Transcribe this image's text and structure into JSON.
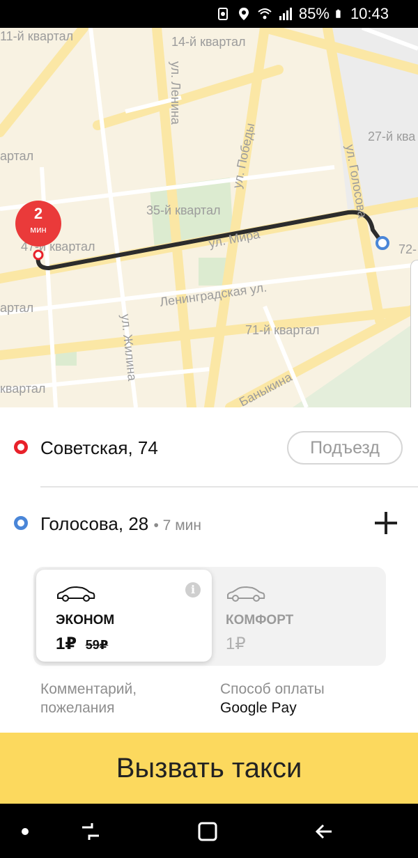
{
  "status_bar": {
    "battery": "85%",
    "time": "10:43"
  },
  "map": {
    "labels": [
      "11-й квартал",
      "14-й квартал",
      "ул. Ленина",
      "ул. Победы",
      "ул. Голосова",
      "27-й ква",
      "артал",
      "35-й квартал",
      "47-й квартал",
      "ул. Мира",
      "72-",
      "артал",
      "Ленинградская ул.",
      "71-й квартал",
      "ул. Жилина",
      "квартал",
      "Баныкина"
    ],
    "eta": {
      "value": "2",
      "unit": "мин"
    }
  },
  "route": {
    "from": {
      "address": "Советская, 74",
      "entrance_label": "Подъезд"
    },
    "to": {
      "address": "Голосова, 28",
      "time": "• 7 мин"
    }
  },
  "tariffs": [
    {
      "name": "ЭКОНОМ",
      "price": "1₽",
      "old_price": "59₽"
    },
    {
      "name": "КОМФОРТ",
      "price": "1₽"
    }
  ],
  "options": {
    "comment": {
      "line1": "Комментарий,",
      "line2": "пожелания"
    },
    "payment": {
      "label": "Способ оплаты",
      "value": "Google Pay"
    }
  },
  "call_button": "Вызвать такси",
  "colors": {
    "accent_yellow": "#fcd95e",
    "origin_red": "#e8212a",
    "dest_blue": "#4a86d8",
    "eta_red": "#ea3a3a"
  }
}
